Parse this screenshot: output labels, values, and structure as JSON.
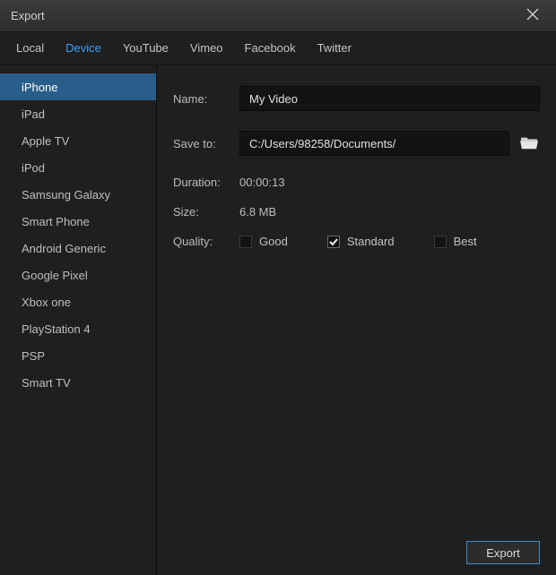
{
  "window": {
    "title": "Export"
  },
  "tabs": {
    "local": "Local",
    "device": "Device",
    "youtube": "YouTube",
    "vimeo": "Vimeo",
    "facebook": "Facebook",
    "twitter": "Twitter"
  },
  "sidebar": {
    "items": [
      {
        "label": "iPhone"
      },
      {
        "label": "iPad"
      },
      {
        "label": "Apple TV"
      },
      {
        "label": "iPod"
      },
      {
        "label": "Samsung Galaxy"
      },
      {
        "label": "Smart Phone"
      },
      {
        "label": "Android Generic"
      },
      {
        "label": "Google Pixel"
      },
      {
        "label": "Xbox one"
      },
      {
        "label": "PlayStation 4"
      },
      {
        "label": "PSP"
      },
      {
        "label": "Smart TV"
      }
    ]
  },
  "form": {
    "name_label": "Name:",
    "name_value": "My Video",
    "saveto_label": "Save to:",
    "saveto_value": "C:/Users/98258/Documents/",
    "duration_label": "Duration:",
    "duration_value": "00:00:13",
    "size_label": "Size:",
    "size_value": "6.8 MB",
    "quality_label": "Quality:",
    "quality_options": {
      "good": "Good",
      "standard": "Standard",
      "best": "Best"
    }
  },
  "footer": {
    "export_label": "Export"
  }
}
